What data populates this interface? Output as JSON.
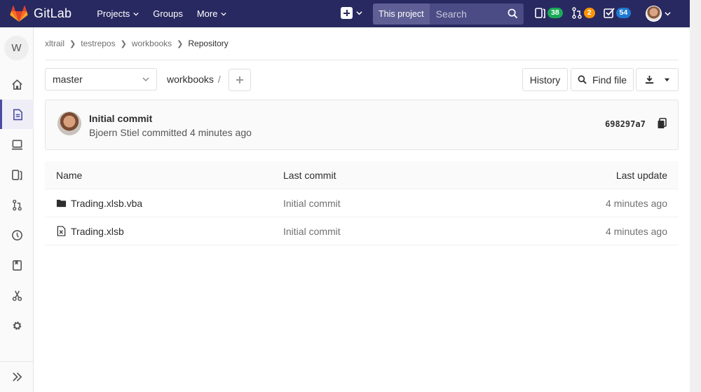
{
  "topbar": {
    "brand": "GitLab",
    "nav": [
      {
        "label": "Projects",
        "caret": true
      },
      {
        "label": "Groups",
        "caret": false
      },
      {
        "label": "More",
        "caret": true
      }
    ],
    "search_scope": "This project",
    "search_placeholder": "Search",
    "counters": [
      {
        "icon": "issues-icon",
        "count": "38",
        "color": "#1aaa55"
      },
      {
        "icon": "merge-request-icon",
        "count": "2",
        "color": "#fc9403"
      },
      {
        "icon": "todo-icon",
        "count": "54",
        "color": "#1f78d1"
      }
    ]
  },
  "sidebar": {
    "project_letter": "W",
    "items": [
      "home-icon",
      "repository-icon",
      "cicd-icon",
      "issues-icon",
      "merge-request-icon",
      "operations-icon",
      "wiki-icon",
      "snippets-icon",
      "settings-icon"
    ],
    "active_item": "repository-icon"
  },
  "breadcrumb": {
    "items": [
      "xltrail",
      "testrepos",
      "workbooks"
    ],
    "current": "Repository"
  },
  "tree_header": {
    "branch": "master",
    "path": "workbooks",
    "path_sep": "/",
    "history_label": "History",
    "find_file_label": "Find file"
  },
  "last_commit": {
    "title": "Initial commit",
    "author": "Bjoern Stiel",
    "meta_suffix": "committed 4 minutes ago",
    "sha": "698297a7"
  },
  "tree": {
    "columns": [
      "Name",
      "Last commit",
      "Last update"
    ],
    "rows": [
      {
        "type": "folder",
        "icon": "folder-icon",
        "name": "Trading.xlsb.vba",
        "commit": "Initial commit",
        "updated": "4 minutes ago"
      },
      {
        "type": "file",
        "icon": "excel-file-icon",
        "name": "Trading.xlsb",
        "commit": "Initial commit",
        "updated": "4 minutes ago"
      }
    ]
  }
}
